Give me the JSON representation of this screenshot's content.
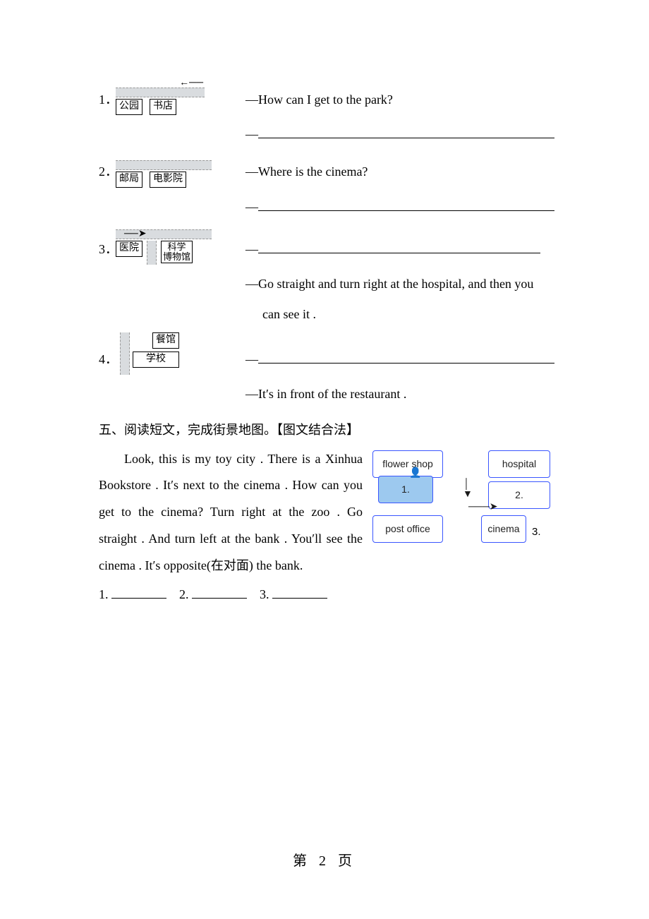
{
  "q1": {
    "num": "1．",
    "box_left": "公园",
    "box_right": "书店",
    "line1": "—How can I get to the park?",
    "dash": "—"
  },
  "q2": {
    "num": "2．",
    "box_left": "邮局",
    "box_right": "电影院",
    "line1": "—Where is the cinema?",
    "dash": "—"
  },
  "q3": {
    "num": "3．",
    "box_left": "医院",
    "box_right_l1": "科学",
    "box_right_l2": "博物馆",
    "dash": "—",
    "ans1": "—Go straight and turn right at the hospital, and then you",
    "ans2": "can see it ."
  },
  "q4": {
    "num": "4．",
    "box_top": "餐馆",
    "box_bottom": "学校",
    "dash": "—",
    "ans": "—It′s in front of the restaurant ."
  },
  "section5": {
    "title": "五、阅读短文，完成街景地图。【图文结合法】",
    "paragraph": "Look, this is my toy city . There is a Xinhua Bookstore . It′s next to the cinema . How can you get to the cinema? Turn right at the zoo . Go straight . And turn left at the bank . You′ll see the cinema . It′s opposite(在对面) the bank.",
    "blanks": {
      "n1": "1. ",
      "n2": "2. ",
      "n3": "3. "
    },
    "map": {
      "flower_shop": "flower shop",
      "hospital": "hospital",
      "b1": "1.",
      "b2": "2.",
      "post_office": "post office",
      "cinema": "cinema",
      "b3": "3."
    }
  },
  "footer": "第 2 页"
}
